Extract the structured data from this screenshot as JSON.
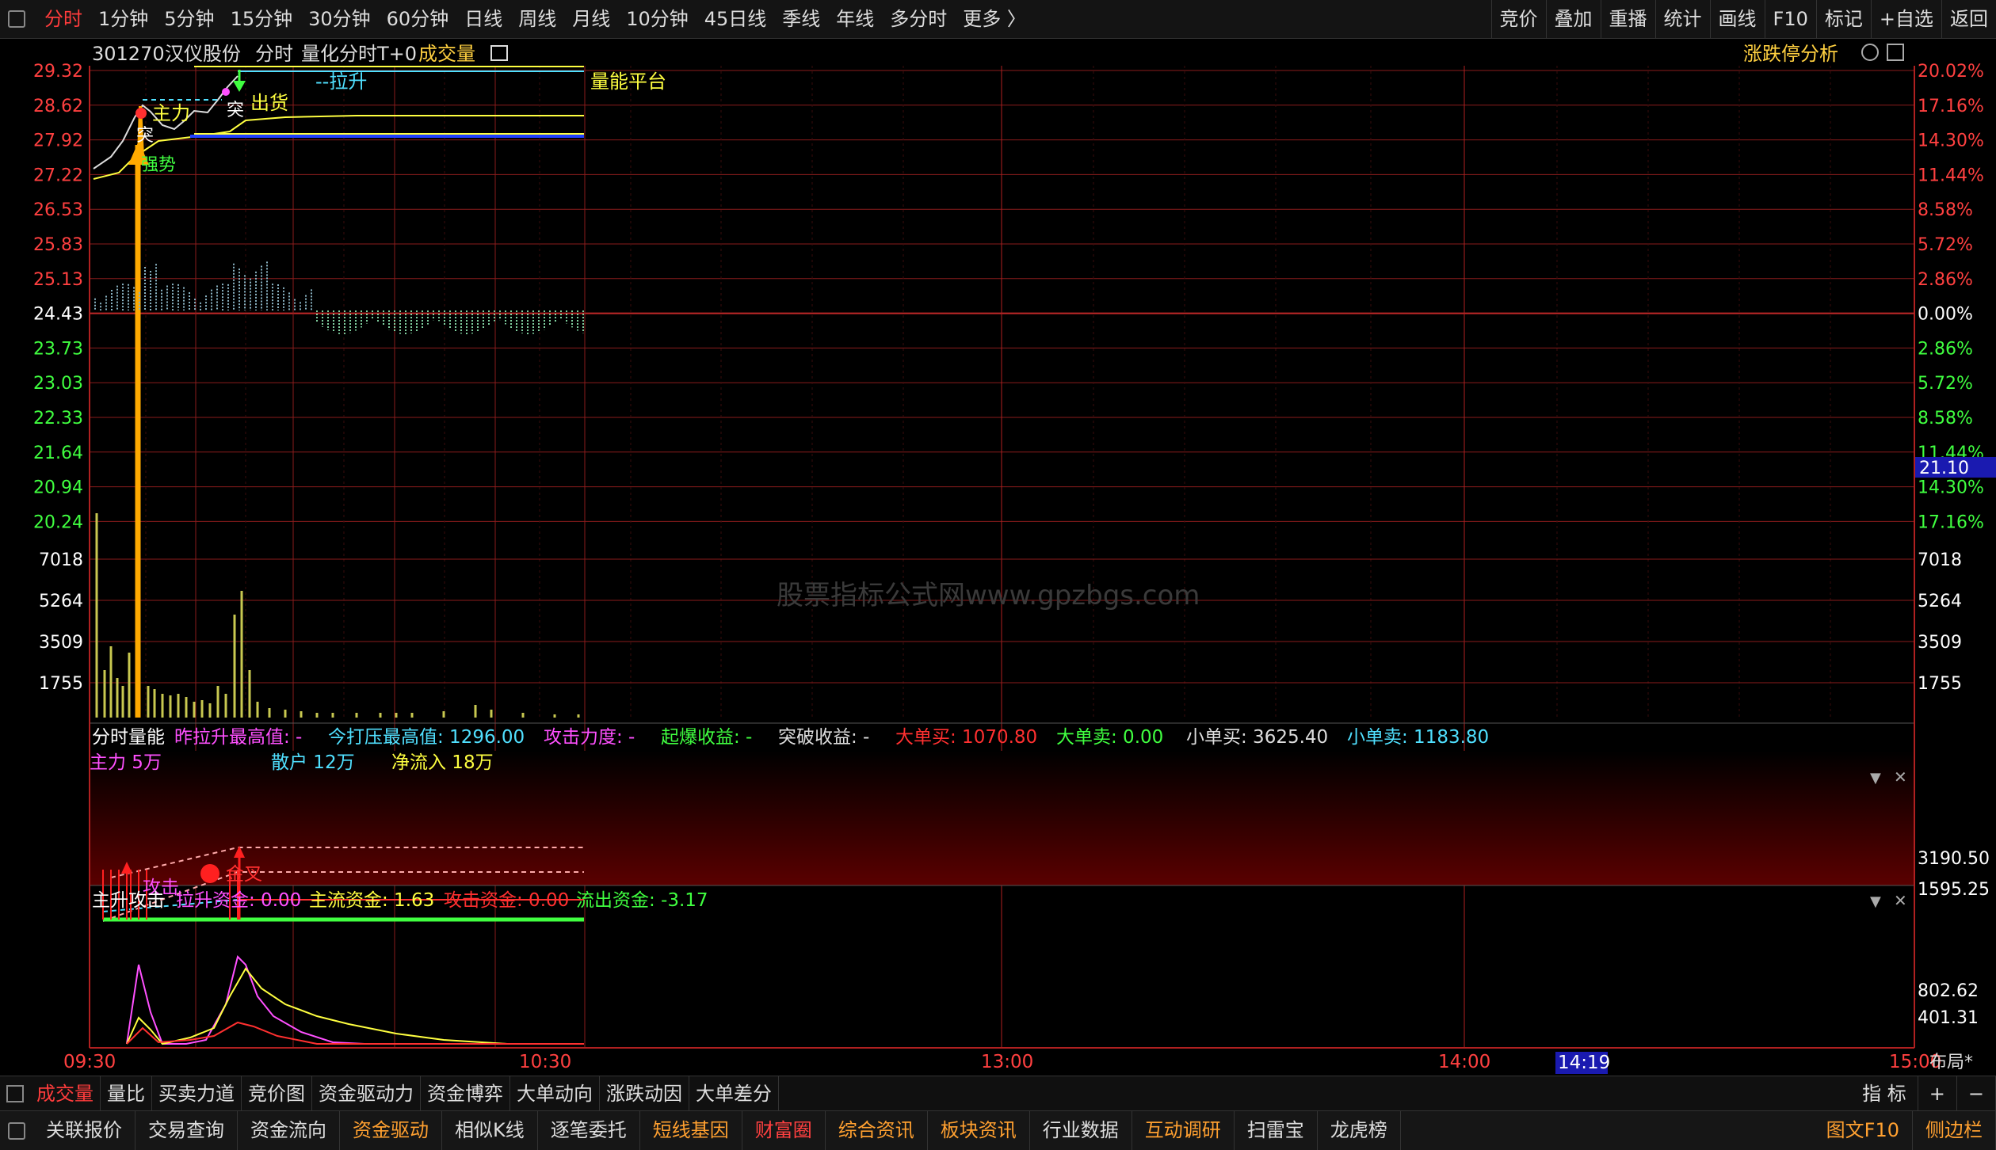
{
  "topbar": {
    "tabs": [
      "分时",
      "1分钟",
      "5分钟",
      "15分钟",
      "30分钟",
      "60分钟",
      "日线",
      "周线",
      "月线",
      "10分钟",
      "45日线",
      "季线",
      "年线",
      "多分时",
      "更多 〉"
    ],
    "right": [
      "竞价",
      "叠加",
      "重播",
      "统计",
      "画线",
      "F10",
      "标记",
      "+自选",
      "返回"
    ]
  },
  "header": {
    "code": "301270",
    "name": "汉仪股份",
    "mode": "分时",
    "indicator": "量化分时T+0",
    "volume_label": "成交量",
    "analysis": "涨跌停分析"
  },
  "annotations": {
    "lashen": "--拉升",
    "liang_ping": "量能平台",
    "zhuli": "主力",
    "chuhuo": "出货",
    "tu1": "突",
    "tu2": "突",
    "qiangshi": "强势"
  },
  "price_axis": {
    "left": [
      "29.32",
      "28.62",
      "27.92",
      "27.22",
      "26.53",
      "25.83",
      "25.13",
      "24.43",
      "23.73",
      "23.03",
      "22.33",
      "21.64",
      "20.94",
      "20.24"
    ],
    "right": [
      "20.02%",
      "17.16%",
      "14.30%",
      "11.44%",
      "8.58%",
      "5.72%",
      "2.86%",
      "0.00%",
      "2.86%",
      "5.72%",
      "8.58%",
      "11.44%",
      "14.30%",
      "17.16%"
    ],
    "current_price": "21.10"
  },
  "volume_axis": {
    "left": [
      "7018",
      "5264",
      "3509",
      "1755"
    ],
    "right": [
      "7018",
      "5264",
      "3509",
      "1755"
    ]
  },
  "watermark": "股票指标公式网www.gpzbgs.com",
  "panel1": {
    "title": "分时量能",
    "row1": [
      {
        "label": "昨拉升最高值:",
        "value": "-",
        "color": "#ff50ff"
      },
      {
        "label": "今打压最高值:",
        "value": "1296.00",
        "color": "#50e0ff"
      },
      {
        "label": "攻击力度:",
        "value": "-",
        "color": "#ff50ff"
      },
      {
        "label": "起爆收益:",
        "value": "-",
        "color": "#40ff40"
      },
      {
        "label": "突破收益:",
        "value": "-",
        "color": "#dddddd"
      },
      {
        "label": "大单买:",
        "value": "1070.80",
        "color": "#ff3030"
      },
      {
        "label": "大单卖:",
        "value": "0.00",
        "color": "#40ff40"
      },
      {
        "label": "小单买:",
        "value": "3625.40",
        "color": "#dddddd"
      },
      {
        "label": "小单卖:",
        "value": "1183.80",
        "color": "#50e0ff"
      }
    ],
    "row2": [
      {
        "label": "主力",
        "value": "5万",
        "color": "#ff50ff"
      },
      {
        "label": "散户",
        "value": "12万",
        "color": "#50e0ff"
      },
      {
        "label": "净流入",
        "value": "18万",
        "color": "#ffff40"
      }
    ],
    "labels": {
      "gongji": "攻击",
      "jincha": "金叉"
    },
    "axis": [
      "3190.50",
      "1595.25"
    ]
  },
  "panel2": {
    "title": "主升攻击",
    "items": [
      {
        "label": "拉升资金:",
        "value": "0.00",
        "color": "#ff50ff"
      },
      {
        "label": "主流资金:",
        "value": "1.63",
        "color": "#ffff40"
      },
      {
        "label": "攻击资金:",
        "value": "0.00",
        "color": "#ff3030"
      },
      {
        "label": "流出资金:",
        "value": "-3.17",
        "color": "#40ff40"
      }
    ],
    "axis": [
      "802.62",
      "401.31"
    ]
  },
  "time_axis": {
    "labels": [
      "09:30",
      "10:30",
      "13:00",
      "14:00",
      "15:00"
    ],
    "cursor": "14:19",
    "layout_label": "布局*"
  },
  "bottombar1": {
    "tabs": [
      "成交量",
      "量比",
      "买卖力道",
      "竞价图",
      "资金驱动力",
      "资金博弈",
      "大单动向",
      "涨跌动因",
      "大单差分"
    ],
    "right": [
      "指 标",
      "+",
      "−"
    ]
  },
  "bottombar2": {
    "items": [
      {
        "label": "关联报价",
        "color": "#dddddd"
      },
      {
        "label": "交易查询",
        "color": "#dddddd"
      },
      {
        "label": "资金流向",
        "color": "#dddddd"
      },
      {
        "label": "资金驱动",
        "color": "#ffa030"
      },
      {
        "label": "相似K线",
        "color": "#dddddd"
      },
      {
        "label": "逐笔委托",
        "color": "#dddddd"
      },
      {
        "label": "短线基因",
        "color": "#ffa030"
      },
      {
        "label": "财富圈",
        "color": "#ff4040"
      },
      {
        "label": "综合资讯",
        "color": "#ffa030"
      },
      {
        "label": "板块资讯",
        "color": "#ffa030"
      },
      {
        "label": "行业数据",
        "color": "#dddddd"
      },
      {
        "label": "互动调研",
        "color": "#ffa030"
      },
      {
        "label": "扫雷宝",
        "color": "#dddddd"
      },
      {
        "label": "龙虎榜",
        "color": "#dddddd"
      }
    ],
    "right": [
      "图文F10",
      "侧边栏"
    ]
  }
}
